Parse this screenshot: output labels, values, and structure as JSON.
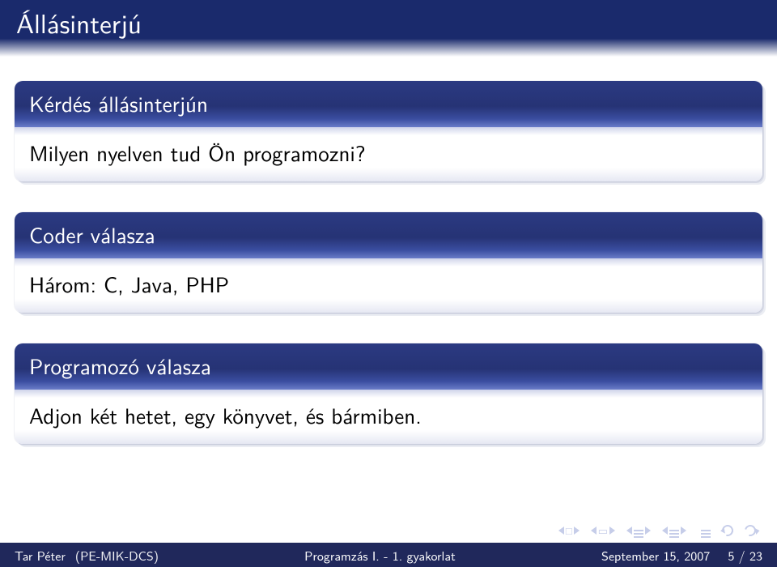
{
  "title": "Állásinterjú",
  "blocks": {
    "question": {
      "header": "Kérdés állásinterjún",
      "body": "Milyen nyelven tud Ön programozni?"
    },
    "coder": {
      "header": "Coder válasza",
      "body": "Három: C, Java, PHP"
    },
    "programmer": {
      "header": "Programozó válasza",
      "body": "Adjon két hetet, egy könyvet, és bármiben."
    }
  },
  "nav": {
    "first": "first-slide",
    "prev": "prev-slide",
    "next": "next-slide",
    "last": "last-slide",
    "back": "back",
    "forward": "forward"
  },
  "footer": {
    "author": "Tar Péter",
    "affiliation": "(PE-MIK-DCS)",
    "talk": "Programzás I. - 1. gyakorlat",
    "date": "September 15, 2007",
    "page_current": "5",
    "page_sep": " / ",
    "page_total": "23"
  }
}
